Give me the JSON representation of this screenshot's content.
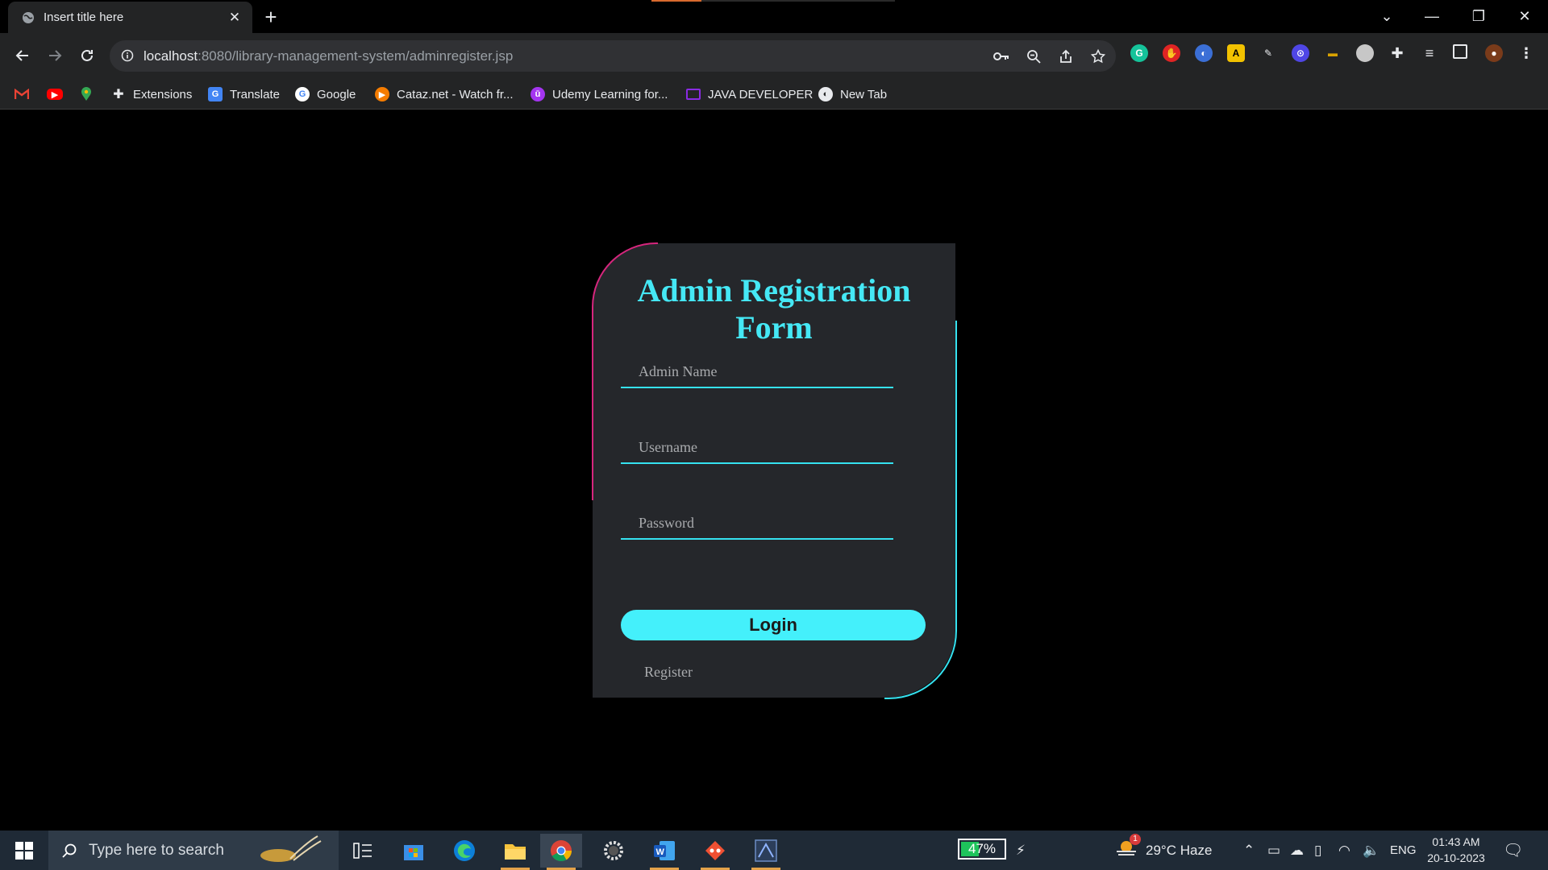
{
  "browser": {
    "tab_title": "Insert title here",
    "url_host": "localhost",
    "url_rest": ":8080/library-management-system/adminregister.jsp",
    "bookmarks": [
      {
        "label": "",
        "icon": "gmail-icon",
        "color": "#d93025"
      },
      {
        "label": "",
        "icon": "youtube-icon",
        "color": "#ff0000"
      },
      {
        "label": "",
        "icon": "maps-icon",
        "color": "#34a853"
      },
      {
        "label": "Extensions",
        "icon": "puzzle-icon",
        "color": "#e8eaed"
      },
      {
        "label": "Translate",
        "icon": "translate-icon",
        "color": "#4285f4"
      },
      {
        "label": "Google",
        "icon": "google-icon",
        "color": "#ffffff"
      },
      {
        "label": "Cataz.net - Watch fr...",
        "icon": "play-icon",
        "color": "#f57c00"
      },
      {
        "label": "Udemy Learning for...",
        "icon": "udemy-icon",
        "color": "#a435f0"
      },
      {
        "label": "JAVA DEVELOPER",
        "icon": "monitor-icon",
        "color": "#8a2be2"
      },
      {
        "label": "New Tab",
        "icon": "globe-icon",
        "color": "#e8eaed"
      }
    ]
  },
  "form": {
    "title": "Admin Registration Form",
    "admin_name_placeholder": "Admin Name",
    "username_placeholder": "Username",
    "password_placeholder": "Password",
    "login_label": "Login",
    "register_label": "Register",
    "colors": {
      "accent": "#45e8f5",
      "pink_edge": "#d6267d",
      "card_bg": "#25272b"
    }
  },
  "taskbar": {
    "search_placeholder": "Type here to search",
    "battery_percent": "47%",
    "battery_level": 0.47,
    "weather": "29°C  Haze",
    "weather_badge": "1",
    "language": "ENG",
    "time": "01:43 AM",
    "date": "20-10-2023"
  }
}
